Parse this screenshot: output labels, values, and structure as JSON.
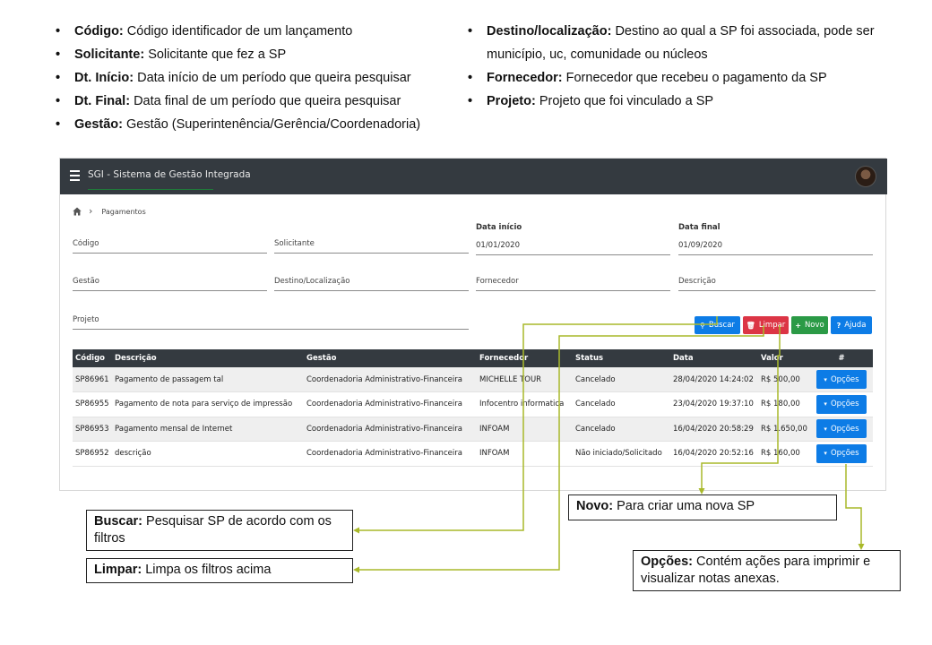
{
  "legend_left": [
    {
      "term": "Código:",
      "desc": "Código identificador de um lançamento"
    },
    {
      "term": "Solicitante:",
      "desc": "Solicitante que fez a SP"
    },
    {
      "term": "Dt. Início:",
      "desc": "Data início de um período que queira pesquisar"
    },
    {
      "term": "Dt. Final:",
      "desc": " Data final de um período que queira pesquisar"
    },
    {
      "term": "Gestão:",
      "desc": "Gestão (Superintenência/Gerência/Coordenadoria)"
    }
  ],
  "legend_right": [
    {
      "term": "Destino/localização:",
      "desc": "Destino ao qual a SP foi associada, pode ser município, uc, comunidade ou núcleos"
    },
    {
      "term": "Fornecedor:",
      "desc": " Fornecedor que recebeu o pagamento da SP"
    },
    {
      "term": "Projeto:",
      "desc": "Projeto que foi vinculado a SP"
    }
  ],
  "app": {
    "title": "SGI - Sistema de Gestão Integrada",
    "breadcrumb": "Pagamentos",
    "filters": {
      "codigo": "Código",
      "solicitante": "Solicitante",
      "data_inicio_label": "Data início",
      "data_inicio_value": "01/01/2020",
      "data_final_label": "Data final",
      "data_final_value": "01/09/2020",
      "gestao": "Gestão",
      "destino": "Destino/Localização",
      "fornecedor": "Fornecedor",
      "descricao": "Descrição",
      "projeto": "Projeto"
    },
    "buttons": {
      "buscar": "Buscar",
      "limpar": "Limpar",
      "novo": "Novo",
      "ajuda": "Ajuda"
    },
    "table": {
      "headers": [
        "Código",
        "Descrição",
        "Gestão",
        "Fornecedor",
        "Status",
        "Data",
        "Valor",
        "#"
      ],
      "options_label": "Opções",
      "rows": [
        {
          "codigo": "SP86961",
          "descricao": "Pagamento de passagem tal",
          "gestao": "Coordenadoria Administrativo-Financeira",
          "fornecedor": "MICHELLE TOUR",
          "status": "Cancelado",
          "data": "28/04/2020 14:24:02",
          "valor": "R$ 500,00"
        },
        {
          "codigo": "SP86955",
          "descricao": "Pagamento de nota para serviço de impressão",
          "gestao": "Coordenadoria Administrativo-Financeira",
          "fornecedor": "Infocentro informatica",
          "status": "Cancelado",
          "data": "23/04/2020 19:37:10",
          "valor": "R$ 180,00"
        },
        {
          "codigo": "SP86953",
          "descricao": "Pagamento mensal de Internet",
          "gestao": "Coordenadoria Administrativo-Financeira",
          "fornecedor": "INFOAM",
          "status": "Cancelado",
          "data": "16/04/2020 20:58:29",
          "valor": "R$ 1.650,00"
        },
        {
          "codigo": "SP86952",
          "descricao": "descrição",
          "gestao": "Coordenadoria Administrativo-Financeira",
          "fornecedor": "INFOAM",
          "status": "Não iniciado/Solicitado",
          "data": "16/04/2020 20:52:16",
          "valor": "R$ 160,00"
        }
      ]
    }
  },
  "callouts": {
    "novo": {
      "term": "Novo:",
      "desc": " Para criar uma nova SP"
    },
    "buscar": {
      "term": "Buscar:",
      "desc": " Pesquisar SP de acordo com os filtros"
    },
    "limpar": {
      "term": "Limpar:",
      "desc": "  Limpa os filtros acima"
    },
    "opcoes": {
      "term": "Opções:",
      "desc": " Contém ações para imprimir e visualizar notas anexas."
    }
  },
  "colors": {
    "navbar": "#343a40",
    "primary": "#0d7ce6",
    "danger": "#dc3545",
    "success": "#2b9a46",
    "connector": "#a9b92a"
  }
}
